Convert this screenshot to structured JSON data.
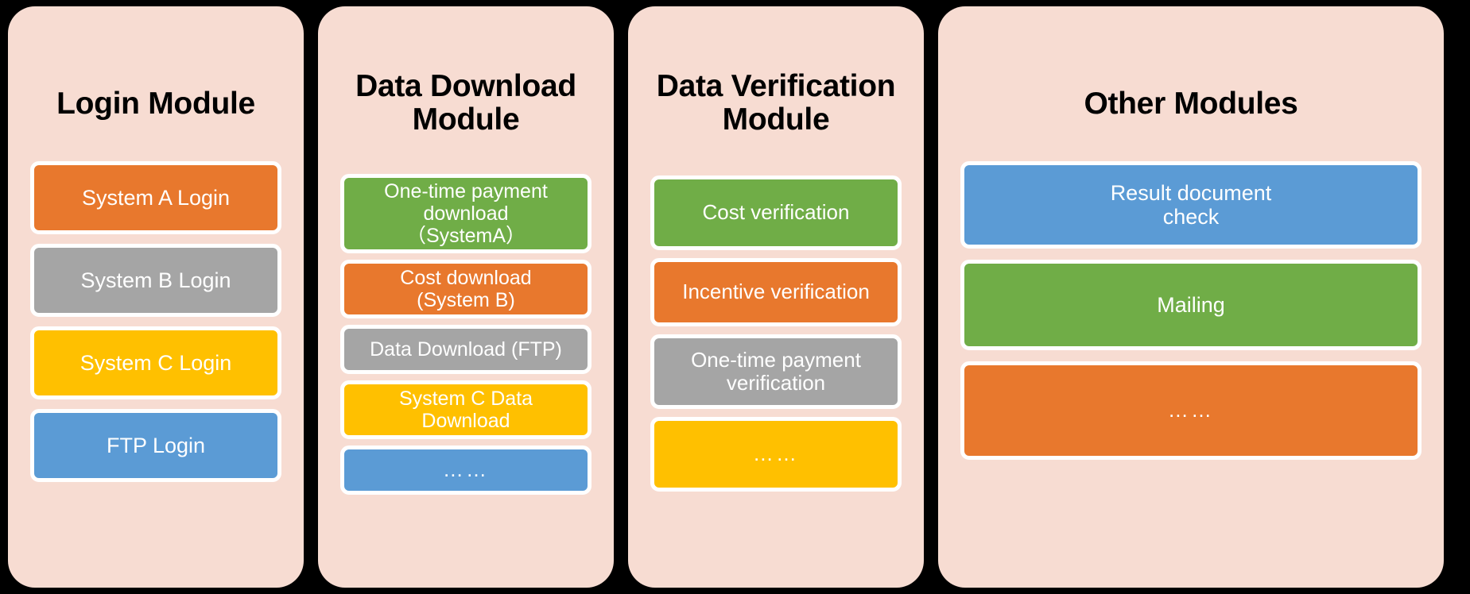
{
  "diagram": {
    "background_color": "#000000",
    "panel_color": "#F7DCD2",
    "palette": {
      "orange": "#E8782D",
      "gray": "#A5A5A5",
      "yellow": "#FFC000",
      "blue": "#5B9BD5",
      "green": "#70AD47",
      "white": "#FFFFFF",
      "title": "#000000"
    },
    "columns": [
      {
        "title": "Login Module",
        "items": [
          {
            "label": "System A Login",
            "color": "#E8782D"
          },
          {
            "label": "System B Login",
            "color": "#A5A5A5"
          },
          {
            "label": "System C Login",
            "color": "#FFC000"
          },
          {
            "label": "FTP Login",
            "color": "#5B9BD5"
          }
        ]
      },
      {
        "title": "Data Download\nModule",
        "items": [
          {
            "label": "One-time payment\ndownload\n（SystemA）",
            "color": "#70AD47"
          },
          {
            "label": "Cost download\n(System B)",
            "color": "#E8782D"
          },
          {
            "label": "Data Download (FTP)",
            "color": "#A5A5A5"
          },
          {
            "label": "System C Data\nDownload",
            "color": "#FFC000"
          },
          {
            "label": "……",
            "color": "#5B9BD5"
          }
        ]
      },
      {
        "title": "Data Verification\nModule",
        "items": [
          {
            "label": "Cost verification",
            "color": "#70AD47"
          },
          {
            "label": "Incentive verification",
            "color": "#E8782D"
          },
          {
            "label": "One-time payment\nverification",
            "color": "#A5A5A5"
          },
          {
            "label": "……",
            "color": "#FFC000"
          }
        ]
      },
      {
        "title": "Other Modules",
        "items": [
          {
            "label": "Result document\ncheck",
            "color": "#5B9BD5"
          },
          {
            "label": "Mailing",
            "color": "#70AD47"
          },
          {
            "label": "……",
            "color": "#E8782D"
          }
        ]
      }
    ]
  }
}
